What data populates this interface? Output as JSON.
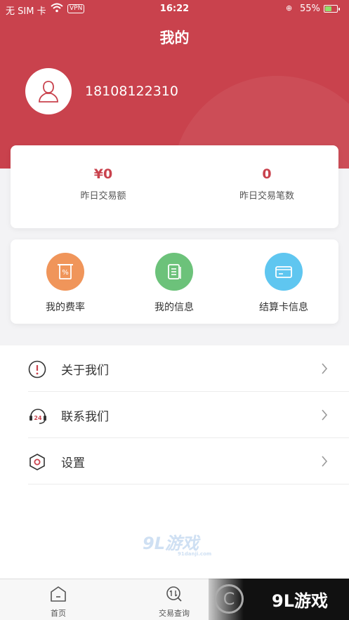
{
  "status_bar": {
    "carrier": "无 SIM 卡",
    "vpn": "VPN",
    "time": "16:22",
    "battery": "55%"
  },
  "header": {
    "title": "我的",
    "phone": "18108122310"
  },
  "stats": {
    "yesterday_amount_value": "¥0",
    "yesterday_amount_label": "昨日交易额",
    "yesterday_count_value": "0",
    "yesterday_count_label": "昨日交易笔数"
  },
  "shortcuts": [
    {
      "label": "我的费率",
      "icon": "rate-icon",
      "color": "#f0955a"
    },
    {
      "label": "我的信息",
      "icon": "info-doc-icon",
      "color": "#6cc27a"
    },
    {
      "label": "结算卡信息",
      "icon": "card-icon",
      "color": "#5fc6f0"
    }
  ],
  "menu": [
    {
      "label": "关于我们",
      "icon": "info-icon"
    },
    {
      "label": "联系我们",
      "icon": "support-24-icon",
      "badge": "24"
    },
    {
      "label": "设置",
      "icon": "settings-hex-icon"
    }
  ],
  "watermark": {
    "text": "9L游戏",
    "sub": "91danji.com"
  },
  "tabbar": [
    {
      "label": "首页",
      "icon": "home-icon"
    },
    {
      "label": "交易查询",
      "icon": "transaction-query-icon"
    }
  ],
  "brand_overlay": {
    "text": "9L游戏"
  },
  "colors": {
    "primary": "#c9424d"
  }
}
